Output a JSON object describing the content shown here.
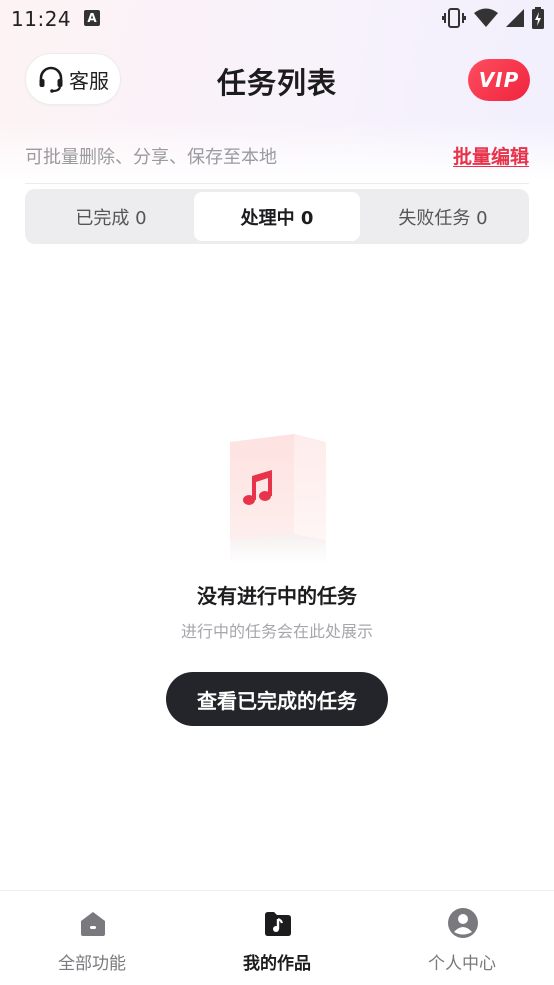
{
  "status_bar": {
    "time": "11:24",
    "notification_icon": "A"
  },
  "header": {
    "customer_service_label": "客服",
    "title": "任务列表",
    "vip_badge": "VIP"
  },
  "toolbar": {
    "hint": "可批量删除、分享、保存至本地",
    "batch_edit_label": "批量编辑"
  },
  "tabs": [
    {
      "label": "已完成 0",
      "active": false
    },
    {
      "label": "处理中 0",
      "active": true
    },
    {
      "label": "失败任务 0",
      "active": false
    }
  ],
  "empty_state": {
    "icon": "music-file-icon",
    "title": "没有进行中的任务",
    "subtitle": "进行中的任务会在此处展示",
    "action_label": "查看已完成的任务"
  },
  "bottom_nav": [
    {
      "label": "全部功能",
      "icon": "home-icon",
      "active": false
    },
    {
      "label": "我的作品",
      "icon": "music-folder-icon",
      "active": true
    },
    {
      "label": "个人中心",
      "icon": "profile-icon",
      "active": false
    }
  ],
  "colors": {
    "accent": "#e8334a",
    "vip_gradient_start": "#ff4d5e",
    "vip_gradient_end": "#f0233f",
    "primary_button": "#23252b",
    "tab_background": "#ededf0"
  }
}
